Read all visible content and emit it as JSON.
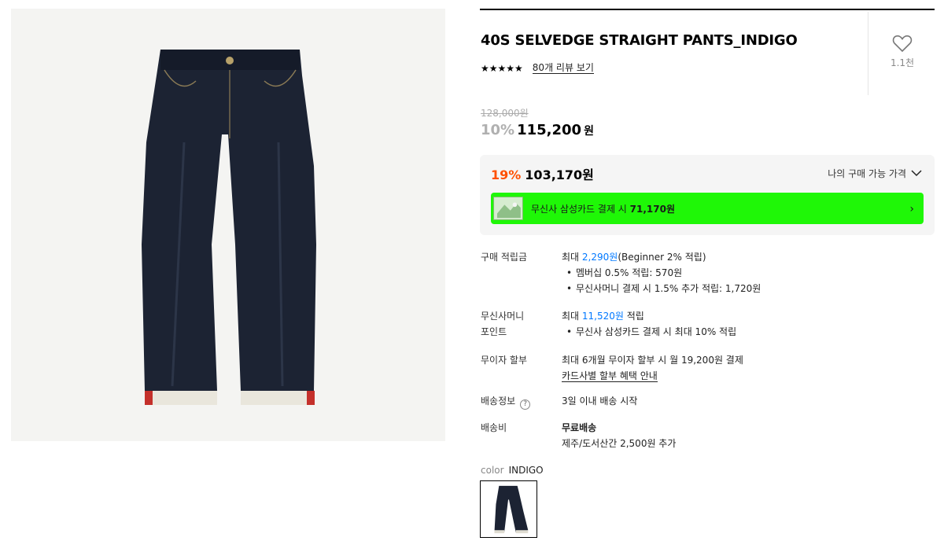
{
  "product": {
    "title": "40S SELVEDGE STRAIGHT PANTS_INDIGO",
    "stars": "★★★★★",
    "review_link": "80개 리뷰 보기",
    "like_count": "1.1천",
    "image_alt": "indigo selvedge straight pants"
  },
  "price": {
    "original": "128,000원",
    "discount_pct": "10%",
    "discount_price": "115,200",
    "won": "원"
  },
  "member_price": {
    "pct": "19%",
    "price": "103,170원",
    "toggle_label": "나의 구매 가능 가격",
    "card_prefix": "무신사 삼성카드 결제 시 ",
    "card_price": "71,170원",
    "banner_color": "#1ff707"
  },
  "details": {
    "points_label": "구매 적립금",
    "points_prefix": "최대 ",
    "points_value": "2,290원",
    "points_suffix": "(Beginner 2% 적립)",
    "points_items": [
      "멤버십 0.5% 적립: 570원",
      "무신사머니 결제 시 1.5% 추가 적립: 1,720원"
    ],
    "money_label_line1": "무신사머니",
    "money_label_line2": "포인트",
    "money_prefix": "최대 ",
    "money_value": "11,520원",
    "money_suffix": " 적립",
    "money_items": [
      "무신사 삼성카드 결제 시 최대 10% 적립"
    ],
    "installment_label": "무이자 할부",
    "installment_text": "최대 6개월 무이자 할부 시 월 19,200원 결제",
    "installment_link": "카드사별 할부 혜택 안내",
    "shipping_label": "배송정보",
    "shipping_help": "?",
    "shipping_text": "3일 이내 배송 시작",
    "fee_label": "배송비",
    "fee_title": "무료배송",
    "fee_text": "제주/도서산간 2,500원 추가"
  },
  "color": {
    "label": "color",
    "value": "INDIGO"
  },
  "colors": {
    "accent_orange": "#ff5000",
    "link_blue": "#0078ff",
    "denim": "#1c2333"
  }
}
